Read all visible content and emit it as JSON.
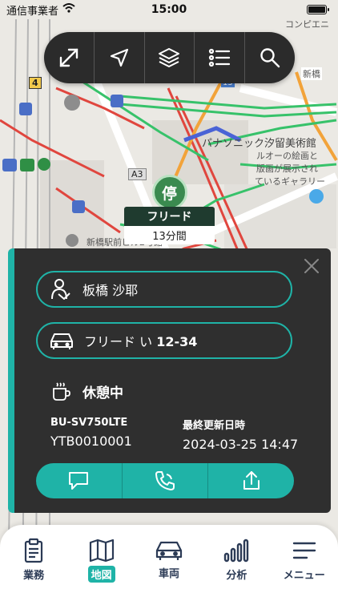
{
  "status_bar": {
    "carrier": "通信事業者",
    "time": "15:00",
    "battery_level": 1.0
  },
  "map": {
    "labels": {
      "top_right": "コンピエニ",
      "shinbashi": "新橋",
      "route_4": "4",
      "route_15": "15",
      "route_a3": "A3",
      "museum": "パナソニック汐留美術館",
      "museum_desc1": "ルオーの絵画と",
      "museum_desc2": "版画が展示され",
      "museum_desc3": "ているギャラリー",
      "station_bldg": "新橋駅前ビル2号館"
    }
  },
  "toolbar": {
    "buttons": [
      {
        "icon": "expand-icon"
      },
      {
        "icon": "navigation-icon"
      },
      {
        "icon": "layers-icon"
      },
      {
        "icon": "list-icon"
      },
      {
        "icon": "search-icon"
      }
    ]
  },
  "marker": {
    "badge": "停",
    "name": "フリード",
    "duration": "13分間"
  },
  "panel": {
    "driver": "板橋 沙耶",
    "vehicle_name": "フリード い",
    "vehicle_plate": "12-34",
    "status": "休憩中",
    "device_label": "BU-SV750LTE",
    "device_id": "YTB0010001",
    "updated_label": "最終更新日時",
    "updated_value": "2024-03-25 14:47"
  },
  "nav": {
    "items": [
      {
        "label": "業務",
        "icon": "clipboard-icon"
      },
      {
        "label": "地図",
        "icon": "map-icon",
        "active": true
      },
      {
        "label": "車両",
        "icon": "car-icon"
      },
      {
        "label": "分析",
        "icon": "chart-icon"
      },
      {
        "label": "メニュー",
        "icon": "menu-icon"
      }
    ]
  },
  "colors": {
    "accent": "#1fb3a7",
    "panel": "#2f2f2f",
    "marker_green": "#3a8a4f"
  }
}
